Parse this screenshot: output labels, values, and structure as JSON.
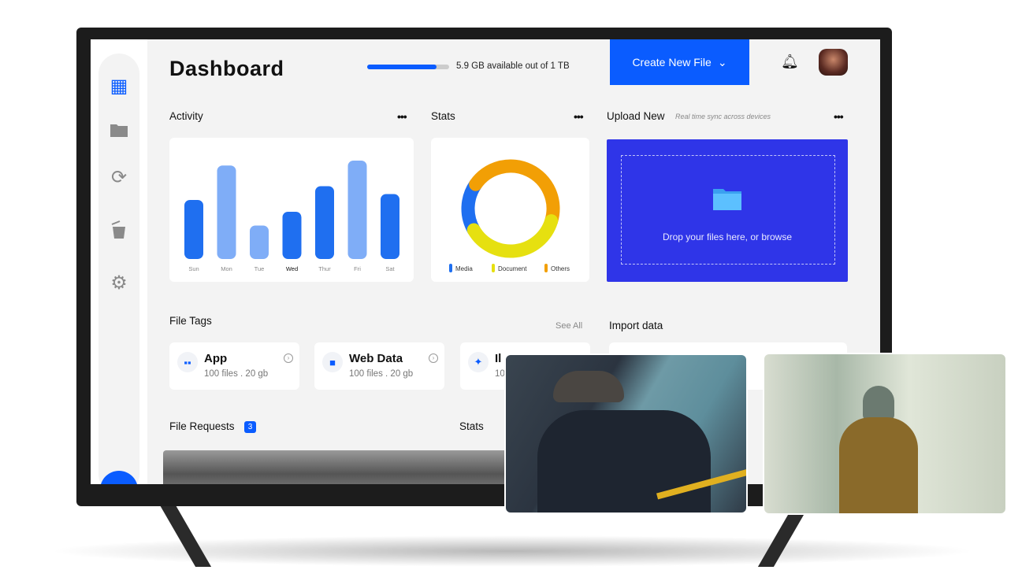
{
  "header": {
    "title": "Dashboard",
    "storage_text": "5.9 GB available out of 1 TB",
    "storage_used_fraction": 0.85,
    "create_button": "Create New File",
    "accent": "#0a5cff"
  },
  "sidebar": {
    "items": [
      {
        "icon": "dashboard-icon",
        "active": true
      },
      {
        "icon": "folder-icon"
      },
      {
        "icon": "sync-icon"
      },
      {
        "icon": "trash-icon"
      },
      {
        "icon": "settings-icon"
      }
    ]
  },
  "activity": {
    "title": "Activity",
    "menu": "•••"
  },
  "stats": {
    "title": "Stats",
    "menu": "•••"
  },
  "upload": {
    "title": "Upload New",
    "subtitle": "Real time sync across devices",
    "menu": "•••",
    "drop_text": "Drop your files here, or browse",
    "bg": "#2f35e8"
  },
  "file_tags": {
    "title": "File Tags",
    "see_all": "See All",
    "items": [
      {
        "name": "App",
        "sub": "100 files . 20 gb"
      },
      {
        "name": "Web Data",
        "sub": "100 files . 20 gb"
      },
      {
        "name": "Il",
        "sub": "10"
      }
    ]
  },
  "import": {
    "title": "Import data"
  },
  "file_requests": {
    "title": "File Requests",
    "badge": "3"
  },
  "stats2": {
    "title": "Stats"
  },
  "chart_data": [
    {
      "type": "bar",
      "categories": [
        "Sun",
        "Mon",
        "Tue",
        "Wed",
        "Thur",
        "Fri",
        "Sat"
      ],
      "values": [
        60,
        95,
        34,
        48,
        74,
        100,
        66
      ],
      "highlight": "Wed",
      "colors": {
        "dark": "#1f6ff0",
        "light": "#7fadf7"
      }
    },
    {
      "type": "pie",
      "donut": true,
      "labels": [
        "Media",
        "Document",
        "Others"
      ],
      "values": [
        18,
        37,
        45
      ],
      "colors": [
        "#1f6ff0",
        "#e6e010",
        "#f29f05"
      ]
    }
  ]
}
